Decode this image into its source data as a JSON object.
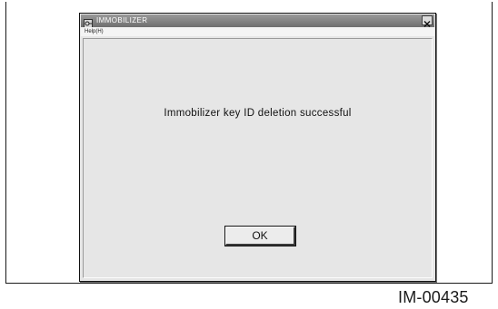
{
  "window": {
    "title": "IMMOBILIZER",
    "icon": "immobilizer-app-icon",
    "close_icon": "close-x-icon"
  },
  "menu": {
    "help_label": "Help(H)"
  },
  "dialog": {
    "message": "Immobilizer key ID deletion successful",
    "ok_label": "OK"
  },
  "figure": {
    "id": "IM-00435"
  }
}
